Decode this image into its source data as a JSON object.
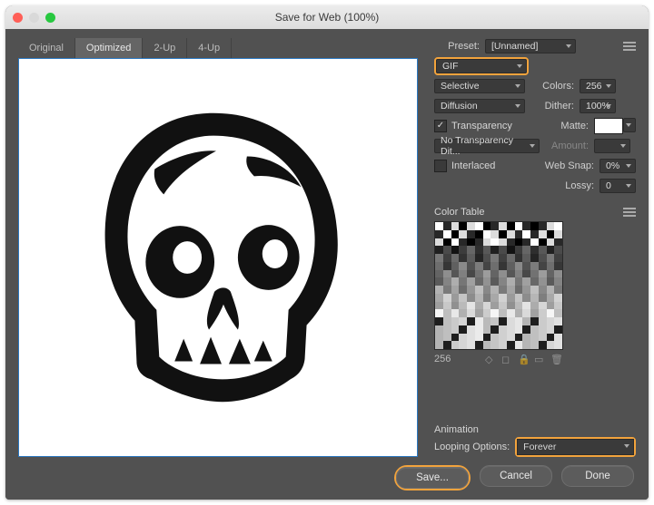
{
  "window": {
    "title": "Save for Web (100%)"
  },
  "tabs": [
    "Original",
    "Optimized",
    "2-Up",
    "4-Up"
  ],
  "active_tab": 1,
  "format_row": {
    "format": "GIF"
  },
  "settings": {
    "preset_label": "Preset:",
    "preset_value": "[Unnamed]",
    "reduction": "Selective",
    "colors_label": "Colors:",
    "colors": "256",
    "diffusion": "Diffusion",
    "dither_label": "Dither:",
    "dither": "100%",
    "transparency_checked": true,
    "transparency_label": "Transparency",
    "matte_label": "Matte:",
    "trans_dither": "No Transparency Dit...",
    "amount_label": "Amount:",
    "amount": "",
    "interlaced_checked": false,
    "interlaced_label": "Interlaced",
    "websnap_label": "Web Snap:",
    "websnap": "0%",
    "lossy_label": "Lossy:",
    "lossy": "0"
  },
  "color_table": {
    "title": "Color Table",
    "count": "256"
  },
  "animation": {
    "title": "Animation",
    "looping_label": "Looping Options:",
    "looping_value": "Forever"
  },
  "buttons": {
    "save": "Save...",
    "cancel": "Cancel",
    "done": "Done"
  }
}
